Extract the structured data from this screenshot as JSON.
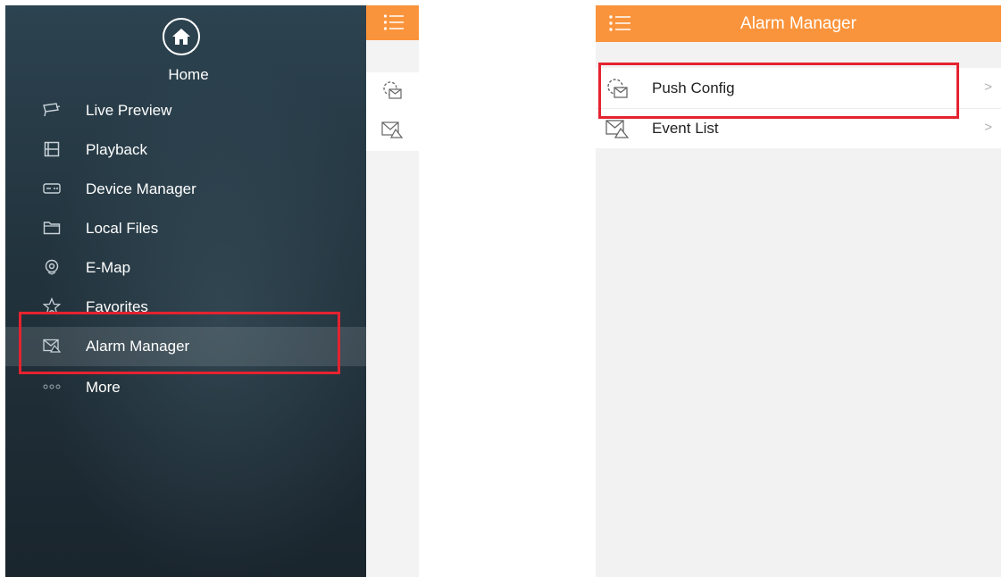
{
  "drawer": {
    "home_label": "Home",
    "items": [
      {
        "label": "Live Preview",
        "icon": "camera-icon"
      },
      {
        "label": "Playback",
        "icon": "film-icon"
      },
      {
        "label": "Device Manager",
        "icon": "device-icon"
      },
      {
        "label": "Local Files",
        "icon": "folder-icon"
      },
      {
        "label": "E-Map",
        "icon": "map-pin-icon"
      },
      {
        "label": "Favorites",
        "icon": "star-icon"
      },
      {
        "label": "Alarm Manager",
        "icon": "alarm-envelope-icon",
        "selected": true
      },
      {
        "label": "More",
        "icon": "more-dots-icon"
      }
    ]
  },
  "alarm_screen": {
    "title": "Alarm Manager",
    "rows": [
      {
        "label": "Push Config",
        "icon": "gear-envelope-icon",
        "arrow": ">"
      },
      {
        "label": "Event List",
        "icon": "alarm-envelope-icon",
        "arrow": ">"
      }
    ]
  },
  "colors": {
    "accent": "#fa943c",
    "drawer_bg": "#22333d",
    "highlight": "#e52330"
  }
}
